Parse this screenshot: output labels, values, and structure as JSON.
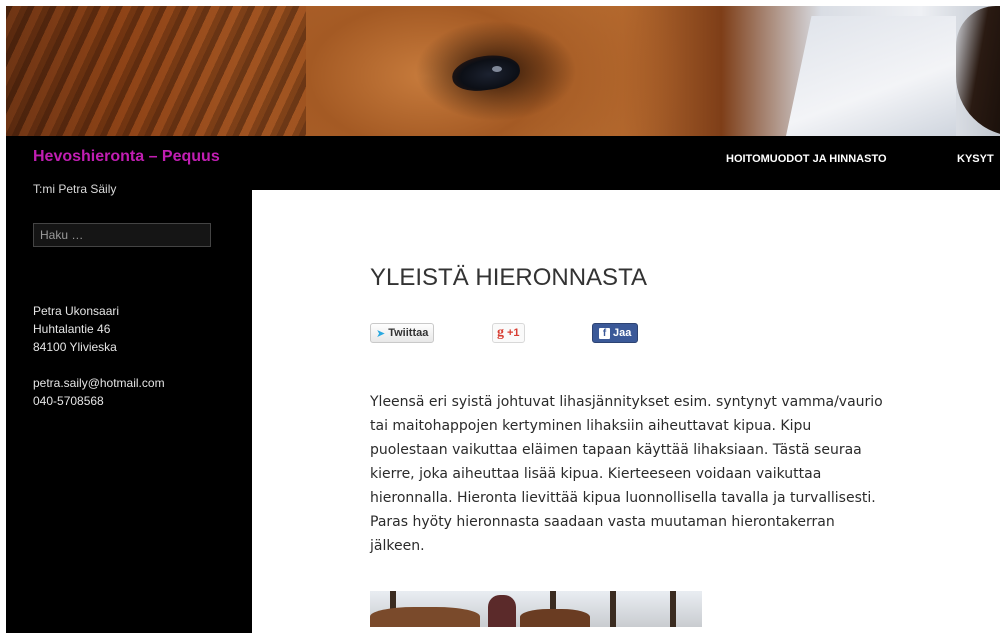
{
  "site": {
    "title": "Hevoshieronta – Pequus",
    "tagline": "T:mi Petra Säily"
  },
  "nav": {
    "items": [
      {
        "label": "HOITOMUODOT JA HINNASTO"
      },
      {
        "label": "KYSYT"
      }
    ]
  },
  "search": {
    "placeholder": "Haku …"
  },
  "contact": {
    "name": "Petra Ukonsaari",
    "street": "Huhtalantie 46",
    "city": "84100 Ylivieska",
    "email": "petra.saily@hotmail.com",
    "phone": "040-5708568"
  },
  "post": {
    "title": "YLEISTÄ HIERONNASTA",
    "body": "Yleensä eri syistä johtuvat lihasjännitykset esim. syntynyt vamma/vaurio tai maitohappojen kertyminen lihaksiin aiheuttavat kipua. Kipu puolestaan vaikuttaa eläimen tapaan käyttää lihaksiaan. Tästä seuraa kierre, joka aiheuttaa lisää kipua. Kierteeseen voidaan vaikuttaa hieronnalla. Hieronta lievittää kipua luonnollisella tavalla ja turvallisesti. Paras hyöty hieronnasta saadaan vasta muutaman hierontakerran jälkeen."
  },
  "share": {
    "twitter_label": "Twiittaa",
    "gplus_label": "+1",
    "gplus_logo": "g",
    "facebook_label": "Jaa",
    "facebook_logo": "f"
  },
  "colors": {
    "site_title": "#c11eb2",
    "background": "#000000",
    "content_background": "#ffffff",
    "facebook": "#3b5998"
  },
  "icons": [
    "twitter-bird-icon",
    "google-plus-icon",
    "facebook-icon"
  ]
}
